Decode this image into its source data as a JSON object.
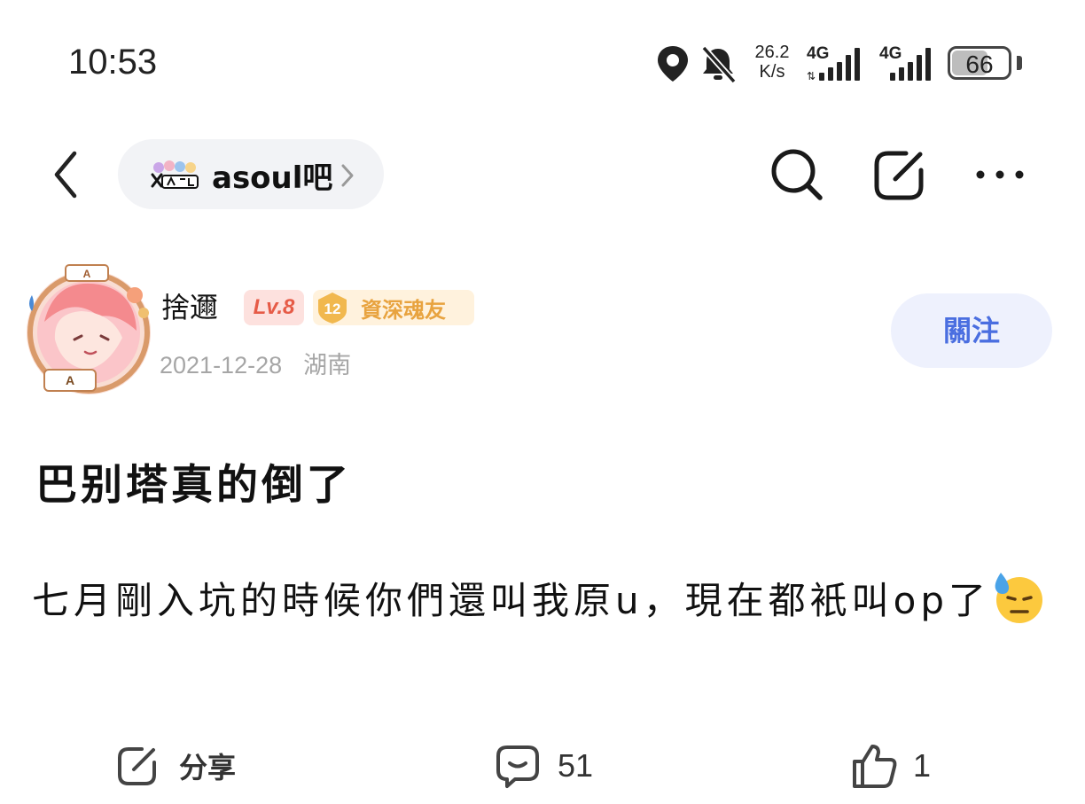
{
  "status_bar": {
    "time": "10:53",
    "net_speed_value": "26.2",
    "net_speed_unit": "K/s",
    "sim1_label": "4G",
    "sim2_label": "4G",
    "battery": "66",
    "battery_level": 0.66,
    "icons": [
      "location-icon",
      "bell-muted-icon",
      "signal-icon",
      "battery-icon"
    ]
  },
  "nav": {
    "forum_name": "asoul吧",
    "icons": [
      "back-icon",
      "forum-logo",
      "chevron-right-icon",
      "search-icon",
      "edit-icon",
      "more-icon"
    ]
  },
  "author": {
    "name": "捨邇",
    "level": "Lv.8",
    "rank_number": "12",
    "rank_title": "資深魂友",
    "date": "2021-12-28",
    "location": "湖南",
    "follow_label": "關注"
  },
  "post": {
    "title": "巴别塔真的倒了",
    "body": "七月剛入坑的時候你們還叫我原u，現在都衹叫op了",
    "emoji": "downcast-sweat-face"
  },
  "actions": {
    "share_label": "分享",
    "comment_count": "51",
    "like_count": "1"
  },
  "colors": {
    "accent": "#4a6ee0",
    "level_badge": "#e65b47",
    "rank_badge": "#e8a33f",
    "meta_text": "#a6a6a6"
  }
}
